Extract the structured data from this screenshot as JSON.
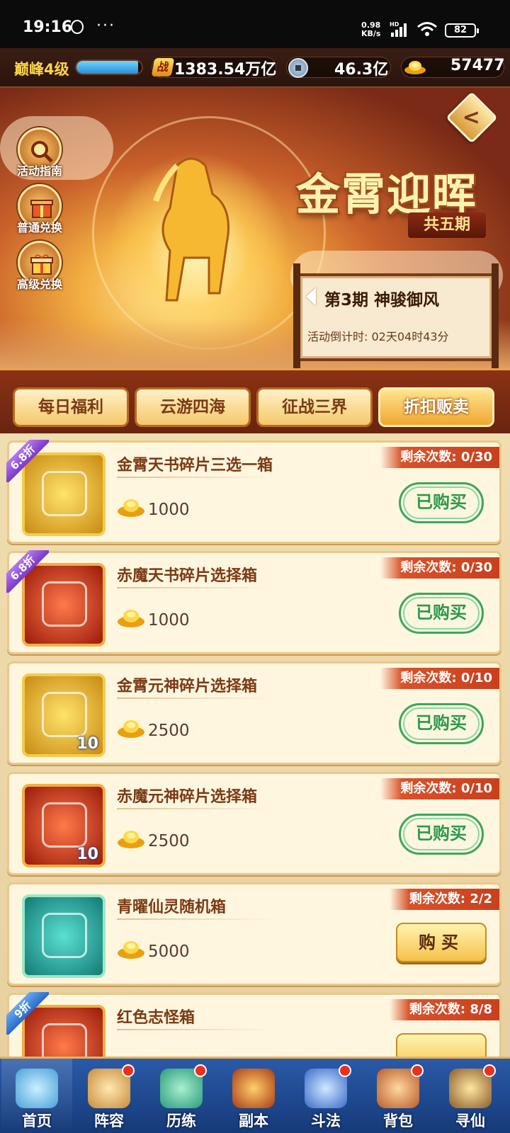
{
  "status_bar": {
    "time": "19:16",
    "more": "···",
    "net_speed_value": "0.98",
    "net_speed_unit": "KB/s",
    "net_type": "HD",
    "battery": "82"
  },
  "topbar": {
    "level_label": "巅峰4级",
    "level_progress": 0.95,
    "power_glyph": "战",
    "power_value": "1383.54万亿",
    "silver_value": "46.3亿",
    "gold_value": "57477"
  },
  "banner": {
    "title": "金霄迎晖",
    "subtitle": "共五期",
    "period_name": "第3期  神骏御风",
    "countdown": "活动倒计时: 02天04时43分",
    "back_glyph": "<",
    "side_buttons": [
      {
        "label": "活动指南",
        "icon": "magnifier-icon"
      },
      {
        "label": "普通兑换",
        "icon": "gift-box-icon"
      },
      {
        "label": "高级兑换",
        "icon": "gift-box-icon"
      }
    ]
  },
  "tabs": [
    {
      "label": "每日福利",
      "active": false
    },
    {
      "label": "云游四海",
      "active": false
    },
    {
      "label": "征战三界",
      "active": false
    },
    {
      "label": "折扣贩卖",
      "active": true
    }
  ],
  "items": [
    {
      "name": "金霄天书碎片三选一箱",
      "price": "1000",
      "remaining": "剩余次数: 0/30",
      "discount": "6.8折",
      "button": "已购买",
      "qty": ""
    },
    {
      "name": "赤魔天书碎片选择箱",
      "price": "1000",
      "remaining": "剩余次数: 0/30",
      "discount": "6.8折",
      "button": "已购买",
      "qty": ""
    },
    {
      "name": "金霄元神碎片选择箱",
      "price": "2500",
      "remaining": "剩余次数: 0/10",
      "discount": "",
      "button": "已购买",
      "qty": "10"
    },
    {
      "name": "赤魔元神碎片选择箱",
      "price": "2500",
      "remaining": "剩余次数: 0/10",
      "discount": "",
      "button": "已购买",
      "qty": "10"
    },
    {
      "name": "青曜仙灵随机箱",
      "price": "5000",
      "remaining": "剩余次数: 2/2",
      "discount": "",
      "button": "购买",
      "qty": ""
    },
    {
      "name": "红色志怪箱",
      "price": "",
      "remaining": "剩余次数: 8/8",
      "discount": "9折",
      "button": "",
      "qty": ""
    }
  ],
  "bottom_nav": [
    {
      "label": "首页",
      "badge": false
    },
    {
      "label": "阵容",
      "badge": true
    },
    {
      "label": "历练",
      "badge": true
    },
    {
      "label": "副本",
      "badge": false
    },
    {
      "label": "斗法",
      "badge": true
    },
    {
      "label": "背包",
      "badge": true
    },
    {
      "label": "寻仙",
      "badge": true
    }
  ],
  "colors": {
    "accent_gold": "#f5c24a",
    "bought_green": "#2a9a4a",
    "remain_red": "#d8522a",
    "nav_blue": "#2a5aa8"
  }
}
